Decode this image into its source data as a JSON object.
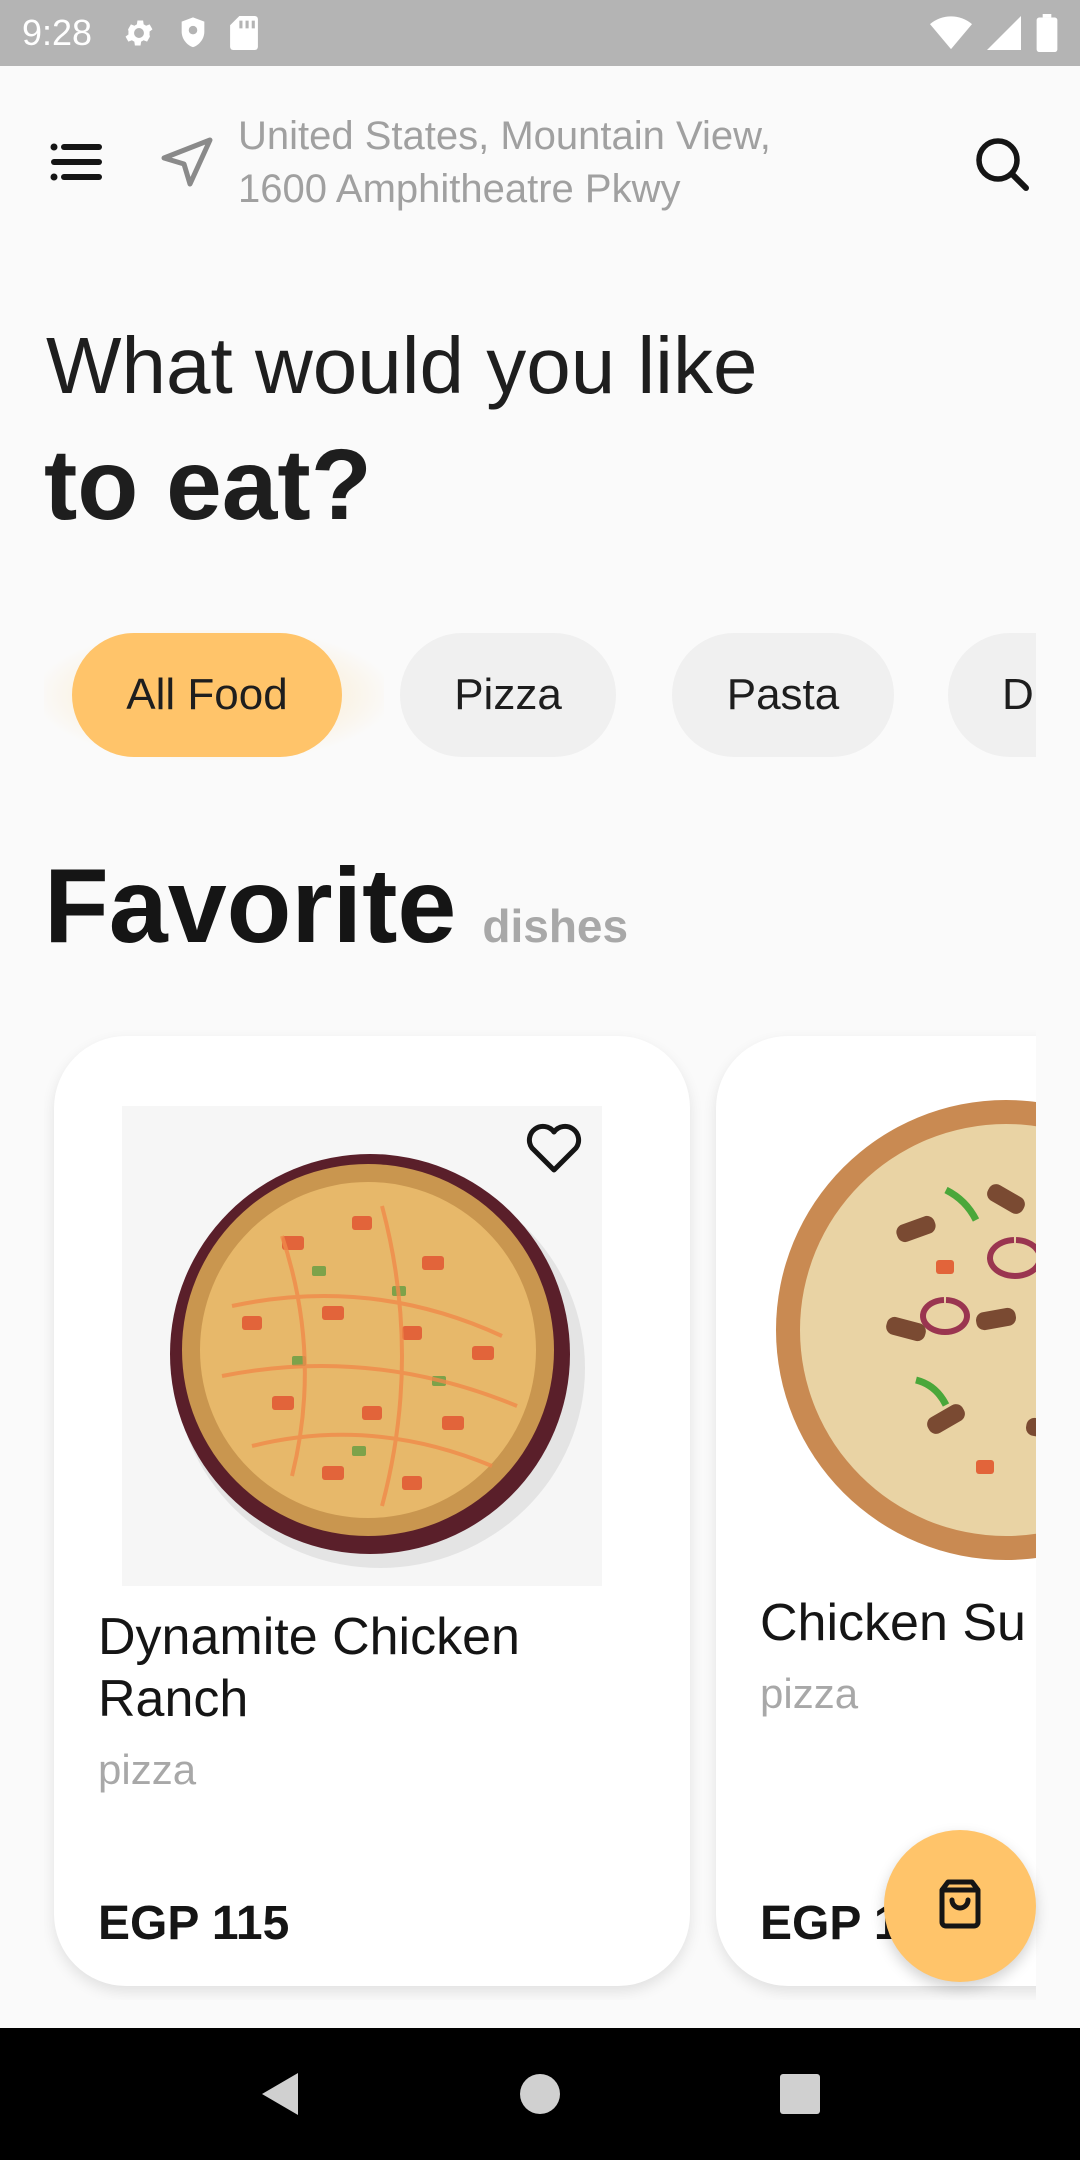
{
  "status_bar": {
    "time": "9:28",
    "left_icons": [
      "settings-icon",
      "shield-icon",
      "sd-card-icon"
    ],
    "right_icons": [
      "wifi-icon",
      "signal-icon",
      "battery-icon"
    ]
  },
  "header": {
    "location_line1": "United States, Mountain View,",
    "location_line2": "1600 Amphitheatre Pkwy"
  },
  "heading": {
    "line1": "What would you like",
    "line2": "to eat?"
  },
  "categories": [
    {
      "label": "All Food",
      "active": true
    },
    {
      "label": "Pizza",
      "active": false
    },
    {
      "label": "Pasta",
      "active": false
    },
    {
      "label": "Dr",
      "active": false
    }
  ],
  "section": {
    "title": "Favorite",
    "subtitle": "dishes"
  },
  "dishes": [
    {
      "name": "Dynamite Chicken Ranch",
      "category": "pizza",
      "price": "EGP 115",
      "favorite": false
    },
    {
      "name": "Chicken Su",
      "category": "pizza",
      "price": "EGP 1"
    }
  ],
  "colors": {
    "accent": "#ffc46a",
    "background": "#fafafa",
    "status_bar": "#b4b4b4",
    "muted_text": "#a0a0a0"
  }
}
